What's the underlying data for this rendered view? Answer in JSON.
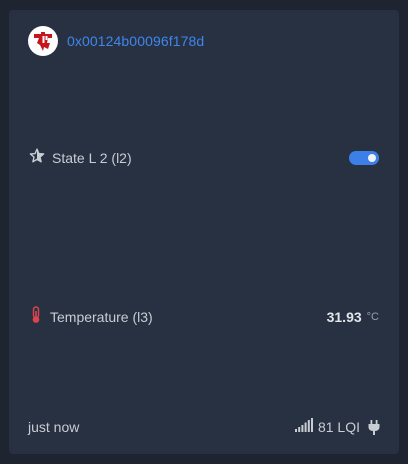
{
  "device": {
    "id": "0x00124b00096f178d",
    "vendor_icon": "texas-instruments-logo-icon"
  },
  "features": [
    {
      "icon": "star-icon",
      "label": "State L 2 (l2)",
      "control": "toggle",
      "state": "on"
    },
    {
      "icon": "thermometer-icon",
      "label": "Temperature (l3)",
      "value": "31.93",
      "unit": "°C"
    }
  ],
  "footer": {
    "last_seen": "just now",
    "lqi_icon": "signal-strength-icon",
    "lqi_text": "81 LQI",
    "power_icon": "mains-plug-icon"
  },
  "colors": {
    "background": "#1e2430",
    "card": "#283142",
    "accent": "#3d7fe8",
    "link": "#3f86ee",
    "thermometer": "#e0434c",
    "vendor_logo": "#c4161c"
  }
}
